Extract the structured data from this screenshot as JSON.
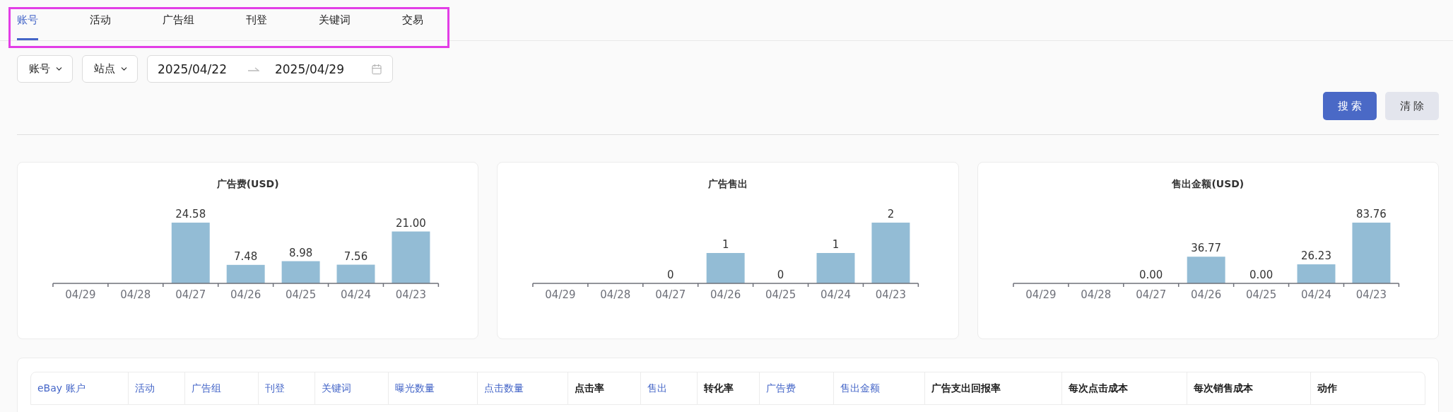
{
  "tabs": [
    {
      "label": "账号",
      "selected": true
    },
    {
      "label": "活动",
      "selected": false
    },
    {
      "label": "广告组",
      "selected": false
    },
    {
      "label": "刊登",
      "selected": false
    },
    {
      "label": "关键词",
      "selected": false
    },
    {
      "label": "交易",
      "selected": false
    }
  ],
  "filters": {
    "dropdowns": [
      "账号",
      "站点"
    ],
    "date_range": {
      "start": "2025/04/22",
      "end": "2025/04/29"
    }
  },
  "buttons": [
    {
      "label": "搜 索",
      "kind": "primary"
    },
    {
      "label": "清 除",
      "kind": "secondary"
    }
  ],
  "charts": [
    {
      "chart_data": {
        "type": "bar",
        "title": "广告费(USD)",
        "categories": [
          "04/29",
          "04/28",
          "04/27",
          "04/26",
          "04/25",
          "04/24",
          "04/23"
        ],
        "values": [
          null,
          null,
          24.58,
          7.48,
          8.98,
          7.56,
          21.0
        ],
        "data_labels": true,
        "value_labels": [
          null,
          null,
          "24.58",
          "7.48",
          "8.98",
          "7.56",
          "21.00"
        ]
      }
    },
    {
      "chart_data": {
        "type": "bar",
        "title": "广告售出",
        "categories": [
          "04/29",
          "04/28",
          "04/27",
          "04/26",
          "04/25",
          "04/24",
          "04/23"
        ],
        "values": [
          null,
          null,
          0,
          1,
          0,
          1,
          2
        ],
        "data_labels": true,
        "value_labels": [
          null,
          null,
          "0",
          "1",
          "0",
          "1",
          "2"
        ]
      }
    },
    {
      "chart_data": {
        "type": "bar",
        "title": "售出金额(USD)",
        "categories": [
          "04/29",
          "04/28",
          "04/27",
          "04/26",
          "04/25",
          "04/24",
          "04/23"
        ],
        "values": [
          null,
          null,
          0,
          36.77,
          0,
          26.23,
          83.76
        ],
        "data_labels": true,
        "value_labels": [
          null,
          null,
          "0.00",
          "36.77",
          "0.00",
          "26.23",
          "83.76"
        ]
      }
    }
  ],
  "table": {
    "columns": [
      {
        "label": "eBay 账户",
        "kind": "sortable"
      },
      {
        "label": "活动",
        "kind": "sortable"
      },
      {
        "label": "广告组",
        "kind": "sortable"
      },
      {
        "label": "刊登",
        "kind": "sortable"
      },
      {
        "label": "关键词",
        "kind": "sortable"
      },
      {
        "label": "曝光数量",
        "kind": "sortable"
      },
      {
        "label": "点击数量",
        "kind": "sortable"
      },
      {
        "label": "点击率",
        "kind": "plain"
      },
      {
        "label": "售出",
        "kind": "sortable"
      },
      {
        "label": "转化率",
        "kind": "plain"
      },
      {
        "label": "广告费",
        "kind": "sortable"
      },
      {
        "label": "售出金额",
        "kind": "sortable"
      },
      {
        "label": "广告支出回报率",
        "kind": "plain"
      },
      {
        "label": "每次点击成本",
        "kind": "plain"
      },
      {
        "label": "每次销售成本",
        "kind": "plain"
      },
      {
        "label": "动作",
        "kind": "plain"
      }
    ]
  }
}
